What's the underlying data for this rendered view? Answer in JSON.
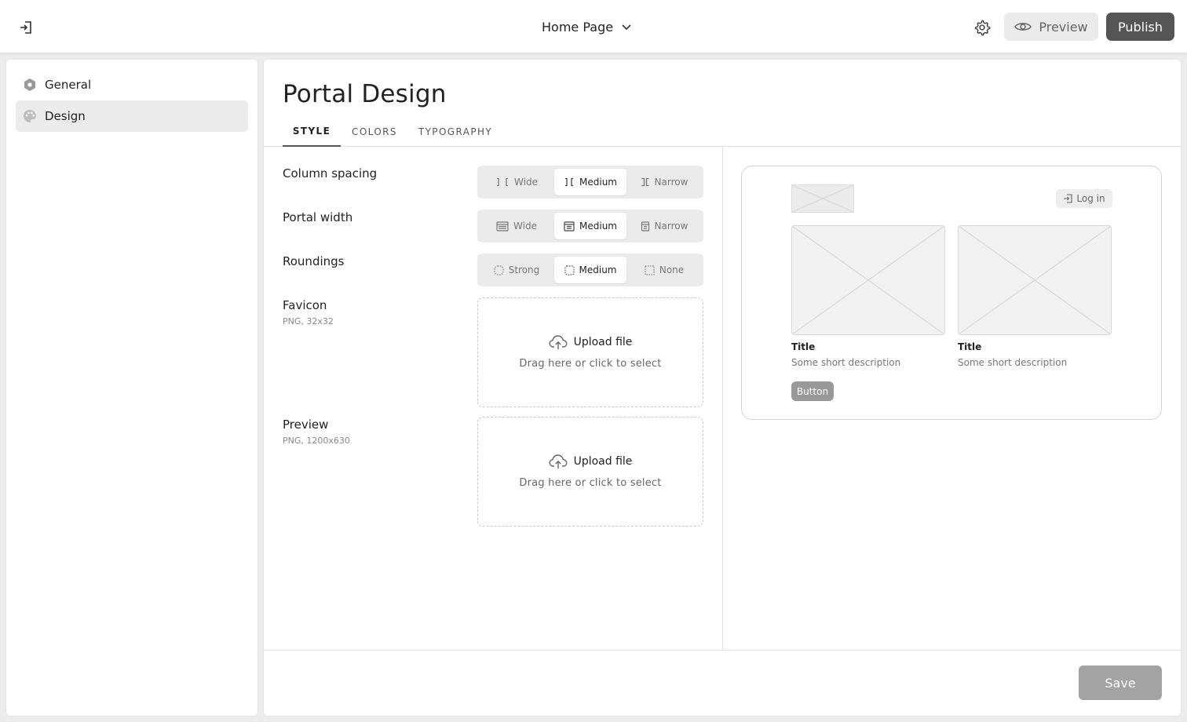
{
  "header": {
    "page_name": "Home Page",
    "preview_label": "Preview",
    "publish_label": "Publish"
  },
  "sidebar": {
    "items": [
      {
        "label": "General",
        "icon": "hexagon-icon",
        "active": false
      },
      {
        "label": "Design",
        "icon": "palette-icon",
        "active": true
      }
    ]
  },
  "main": {
    "title": "Portal Design",
    "tabs": [
      {
        "label": "STYLE",
        "active": true
      },
      {
        "label": "COLORS",
        "active": false
      },
      {
        "label": "TYPOGRAPHY",
        "active": false
      }
    ],
    "fields": {
      "column_spacing": {
        "label": "Column spacing",
        "options": [
          {
            "label": "Wide",
            "icon": "column-wide-icon"
          },
          {
            "label": "Medium",
            "icon": "column-medium-icon"
          },
          {
            "label": "Narrow",
            "icon": "column-narrow-icon"
          }
        ],
        "selected": "Medium"
      },
      "portal_width": {
        "label": "Portal width",
        "options": [
          {
            "label": "Wide",
            "icon": "layout-wide-icon"
          },
          {
            "label": "Medium",
            "icon": "layout-medium-icon"
          },
          {
            "label": "Narrow",
            "icon": "layout-narrow-icon"
          }
        ],
        "selected": "Medium"
      },
      "roundings": {
        "label": "Roundings",
        "options": [
          {
            "label": "Strong",
            "icon": "rounding-strong-icon"
          },
          {
            "label": "Medium",
            "icon": "rounding-medium-icon"
          },
          {
            "label": "None",
            "icon": "rounding-none-icon"
          }
        ],
        "selected": "Medium"
      },
      "favicon": {
        "label": "Favicon",
        "hint": "PNG, 32x32",
        "upload_label": "Upload file",
        "upload_hint": "Drag here or click to select"
      },
      "preview": {
        "label": "Preview",
        "hint": "PNG, 1200x630",
        "upload_label": "Upload file",
        "upload_hint": "Drag here or click to select"
      }
    },
    "save_label": "Save"
  },
  "mock_preview": {
    "login_label": "Log in",
    "cards": [
      {
        "title": "Title",
        "description": "Some short description"
      },
      {
        "title": "Title",
        "description": "Some short description"
      }
    ],
    "button_label": "Button"
  }
}
